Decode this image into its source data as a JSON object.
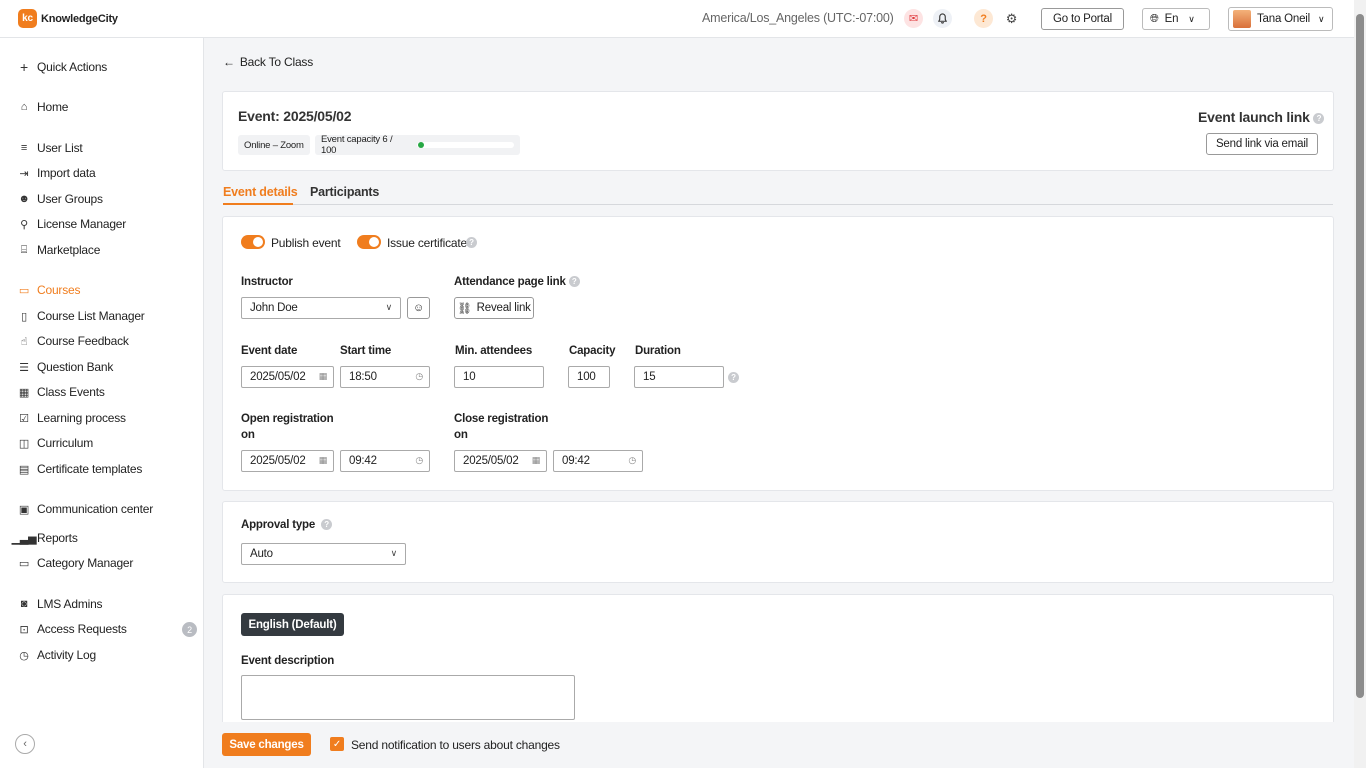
{
  "app": {
    "logo_mark": "kc",
    "logo_text": "KnowledgeCity"
  },
  "header": {
    "timezone": "America/Los_Angeles (UTC:-07:00)",
    "portal_button": "Go to Portal",
    "language": "En",
    "user_name": "Tana Oneil"
  },
  "sidebar": {
    "quick_actions": "Quick Actions",
    "home": "Home",
    "user_list": "User List",
    "import_data": "Import data",
    "user_groups": "User Groups",
    "license_manager": "License Manager",
    "marketplace": "Marketplace",
    "courses": "Courses",
    "course_list_manager": "Course List Manager",
    "course_feedback": "Course Feedback",
    "question_bank": "Question Bank",
    "class_events": "Class Events",
    "learning_process": "Learning process",
    "curriculum": "Curriculum",
    "certificate_templates": "Certificate templates",
    "communication_center": "Communication center",
    "reports": "Reports",
    "category_manager": "Category Manager",
    "lms_admins": "LMS Admins",
    "access_requests": "Access Requests",
    "access_requests_badge": "2",
    "activity_log": "Activity Log"
  },
  "main": {
    "back_link": "Back To Class",
    "event_title": "Event: 2025/05/02",
    "location_chip": "Online – Zoom",
    "capacity_label": "Event capacity 6 / 100",
    "capacity_fraction": 0.06,
    "launch_title": "Event launch link",
    "send_link_button": "Send link via email",
    "tabs": {
      "details": "Event details",
      "participants": "Participants"
    }
  },
  "details": {
    "publish_event": "Publish event",
    "issue_certificate": "Issue certificate",
    "instructor_label": "Instructor",
    "instructor_value": "John Doe",
    "attendance_label": "Attendance page link",
    "reveal_link": "Reveal link",
    "event_date_label": "Event date",
    "event_date_value": "2025/05/02",
    "start_time_label": "Start time",
    "start_time_value": "18:50",
    "min_attendees_label": "Min. attendees",
    "min_attendees_value": "10",
    "capacity_label": "Capacity",
    "capacity_value": "100",
    "duration_label": "Duration",
    "duration_value": "15",
    "open_reg_label_1": "Open registration",
    "open_reg_label_2": "on",
    "open_reg_date": "2025/05/02",
    "open_reg_time": "09:42",
    "close_reg_label_1": "Close registration",
    "close_reg_label_2": "on",
    "close_reg_date": "2025/05/02",
    "close_reg_time": "09:42"
  },
  "approval": {
    "label": "Approval type",
    "value": "Auto"
  },
  "description": {
    "language_button": "English (Default)",
    "label": "Event description"
  },
  "footer": {
    "save_button": "Save changes",
    "notify_label": "Send notification to users about changes"
  },
  "colors": {
    "accent": "#f07d1e",
    "dark": "#343a40",
    "progress": "#27a844"
  }
}
